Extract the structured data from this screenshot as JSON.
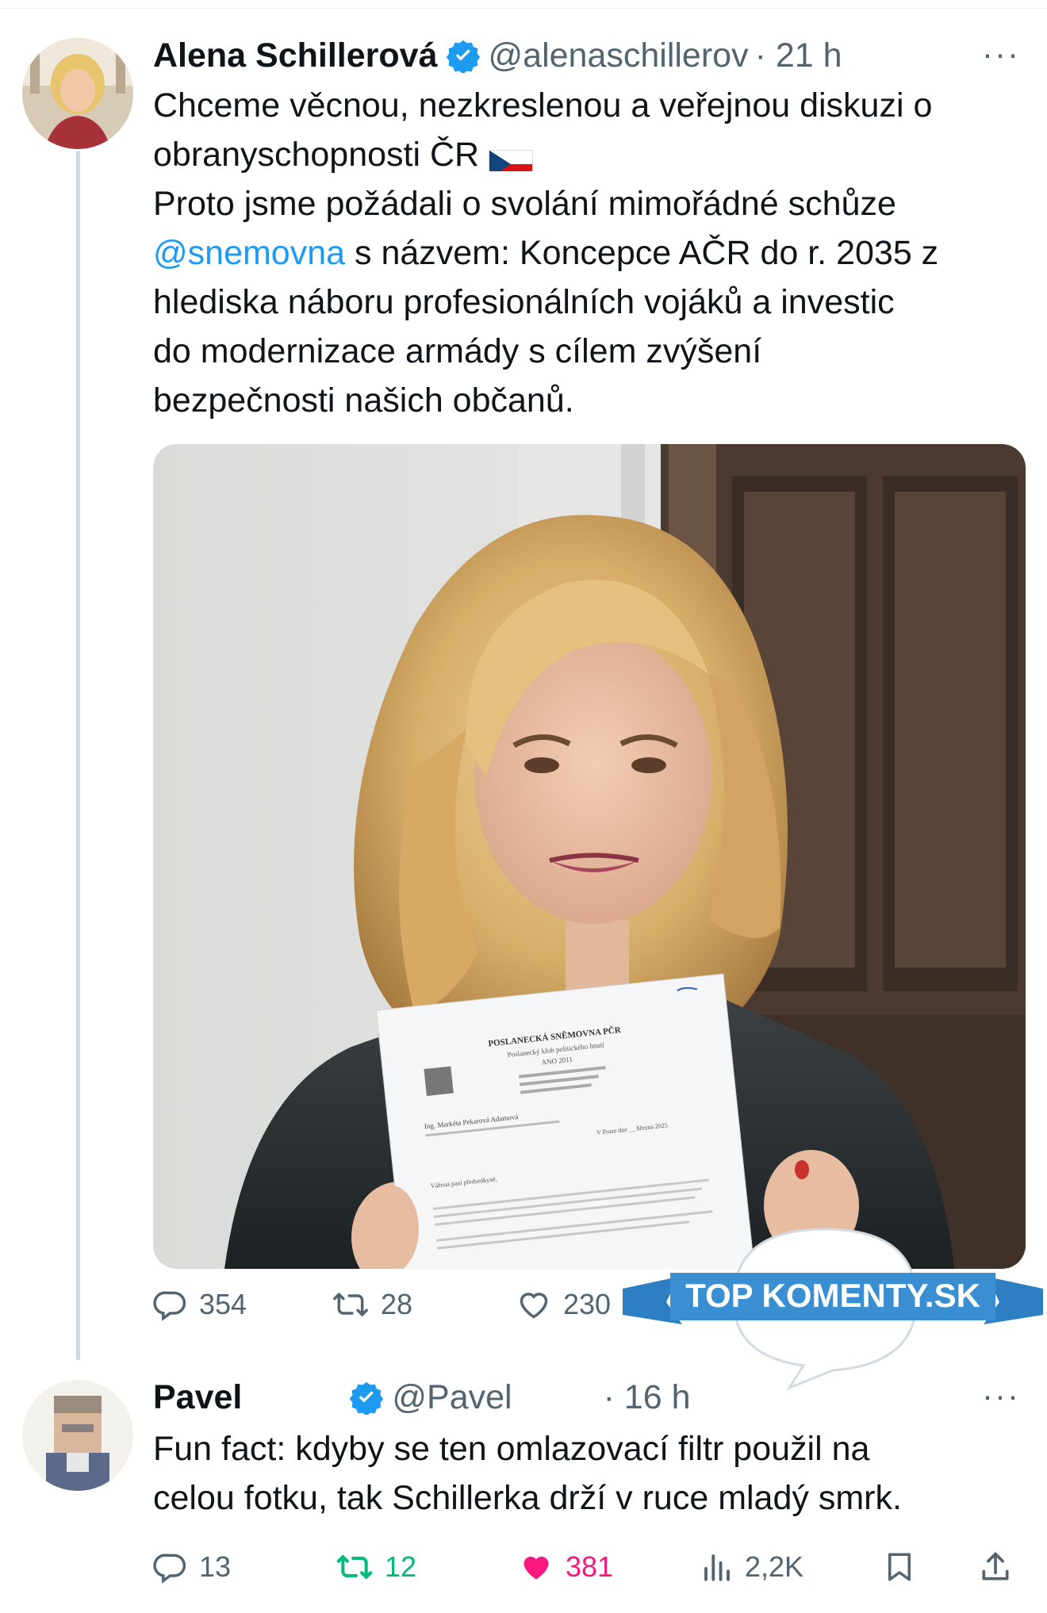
{
  "tweet1": {
    "name": "Alena Schillerová",
    "handle": "@alenaschillerov",
    "time": "· 21 h",
    "text_line1": "Chceme věcnou, nezkreslenou a veřejnou diskuzi o",
    "text_line2": "obranyschopnosti ČR",
    "text_line3": "Proto jsme požádali o svolání mimořádné schůze",
    "mention": "@snemovna",
    "text_line4_rest": " s názvem: Koncepce AČR do r. 2035 z",
    "text_line5": "hlediska náboru profesionálních vojáků a investic",
    "text_line6": "do modernizace armády s cílem zvýšení",
    "text_line7": "bezpečnosti našich občanů.",
    "replies": "354",
    "retweets": "28",
    "likes": "230"
  },
  "document": {
    "heading": "POSLANECKÁ SNĚMOVNA PČR",
    "subheading": "Poslanecký klub politického hnutí",
    "party": "ANO 2011",
    "addressee": "Ing. Markéta Pekarová Adamová",
    "greeting": "Vážená paní předsedkyně,",
    "date_line": "V Praze dne __ března 2025"
  },
  "watermark": {
    "text": "TOP KOMENTY.SK"
  },
  "tweet2": {
    "name": "Pavel",
    "handle": "@Pavel",
    "time": "· 16 h",
    "text_line1": "Fun fact: kdyby se ten omlazovací filtr použil na",
    "text_line2": "celou fotku, tak Schillerka drží v ruce mladý smrk.",
    "replies": "13",
    "retweets": "12",
    "likes": "381",
    "views": "2,2K"
  },
  "colors": {
    "accent": "#1d9bf0",
    "retweet_active": "#00ba7c",
    "like_active": "#f91880",
    "muted": "#536471"
  }
}
